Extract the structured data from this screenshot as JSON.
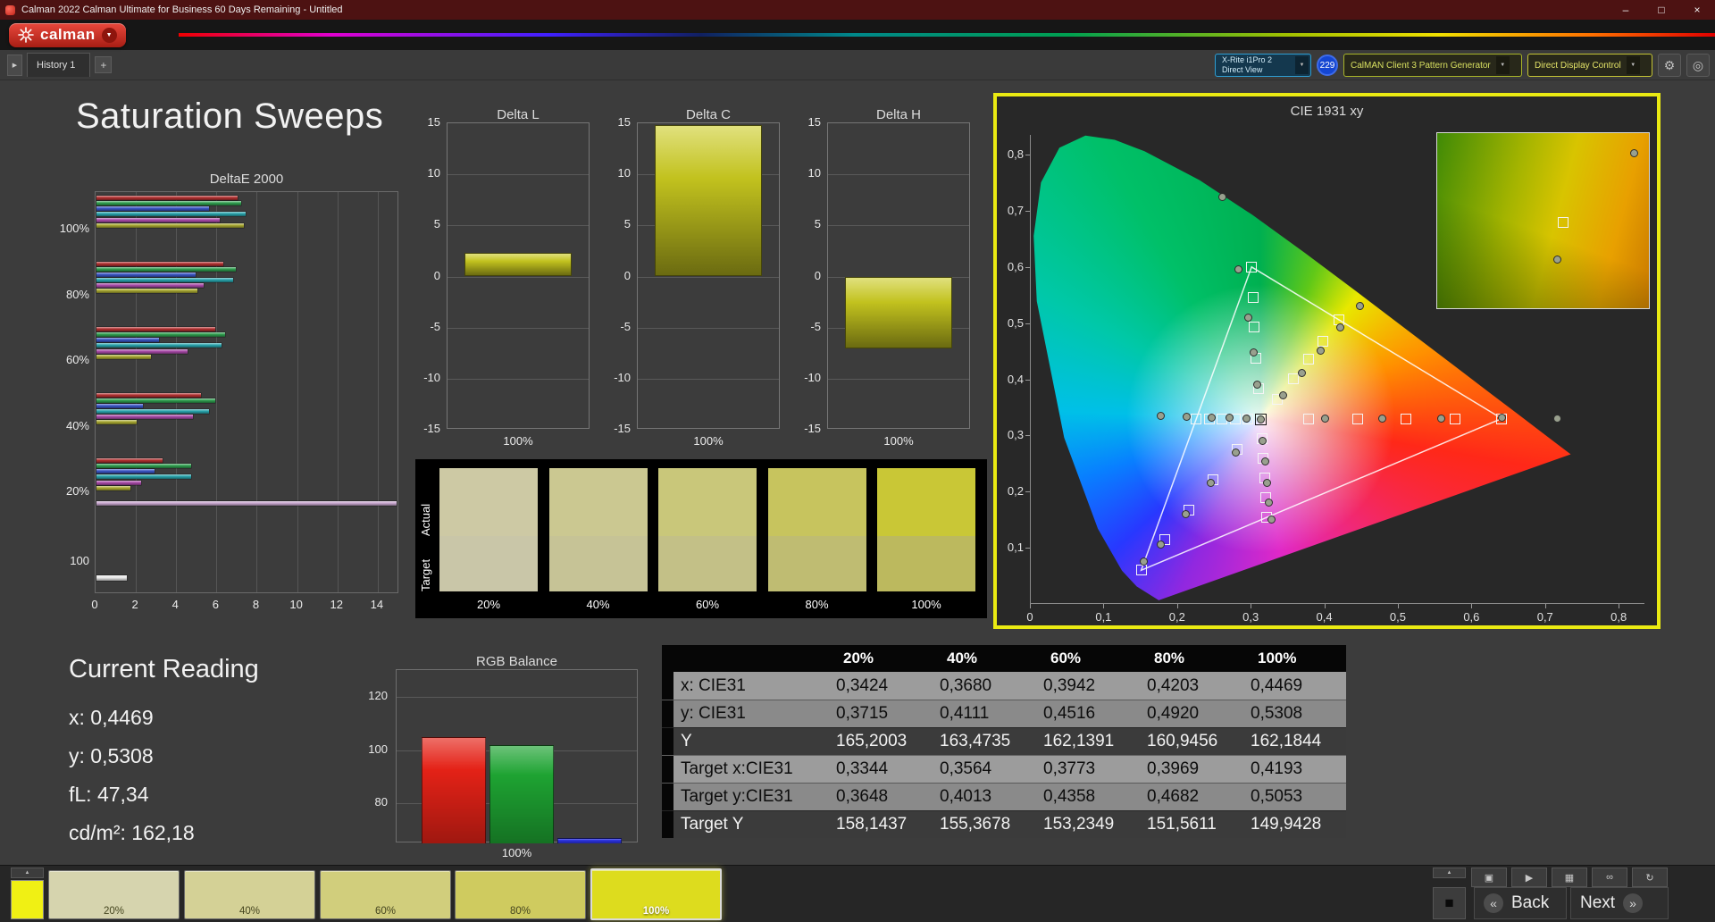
{
  "window": {
    "title": "Calman 2022 Calman Ultimate for Business 60 Days Remaining  - Untitled",
    "minimize": "–",
    "maximize": "□",
    "close": "×"
  },
  "logo": {
    "brand": "calman"
  },
  "tabbar": {
    "scroll_glyph": "▶",
    "history_tab": "History 1",
    "add_tab": "+"
  },
  "devices": {
    "meter_line1": "X-Rite i1Pro 2",
    "meter_line2": "Direct View",
    "badge": "229",
    "source_label": "CalMAN Client 3 Pattern Generator",
    "display_label": "Direct Display Control",
    "caret": "▼",
    "gear": "⚙",
    "target": "◎"
  },
  "page_title": "Saturation Sweeps",
  "deltae": {
    "title": "DeltaE 2000",
    "x_ticks": [
      0,
      2,
      4,
      6,
      8,
      10,
      12,
      14
    ],
    "bar_colors": [
      "#b03030",
      "#2f9e4f",
      "#3a55c4",
      "#2aa4ac",
      "#a84ba8",
      "#a8a832"
    ],
    "groups": [
      {
        "label": "100%",
        "values": [
          7.0,
          7.2,
          5.6,
          7.4,
          6.1,
          7.3
        ]
      },
      {
        "label": "80%",
        "values": [
          6.3,
          6.9,
          4.9,
          6.8,
          5.3,
          5.0
        ]
      },
      {
        "label": "60%",
        "values": [
          5.9,
          6.4,
          3.1,
          6.2,
          4.5,
          2.7
        ]
      },
      {
        "label": "40%",
        "values": [
          5.2,
          5.9,
          2.3,
          5.6,
          4.8,
          2.0
        ]
      },
      {
        "label": "20%",
        "values": [
          3.3,
          4.7,
          2.9,
          4.7,
          2.2,
          1.7
        ]
      }
    ],
    "overflow_bar": {
      "value": 14.9,
      "color": "#c9a8d0"
    },
    "white_bar": {
      "label": "100",
      "value": 1.5,
      "color": "#e8e8e8"
    }
  },
  "delta_axis": {
    "min": -15,
    "max": 15,
    "ticks": [
      15,
      10,
      5,
      0,
      -5,
      -10,
      -15
    ]
  },
  "delta_charts": [
    {
      "title": "Delta L",
      "value": 2.3,
      "x_label": "100%"
    },
    {
      "title": "Delta C",
      "value": 14.8,
      "x_label": "100%"
    },
    {
      "title": "Delta H",
      "value": -7.0,
      "x_label": "100%"
    }
  ],
  "patches": {
    "row_labels": [
      "Actual",
      "Target"
    ],
    "columns": [
      {
        "label": "20%",
        "actual": "#cdc9a4",
        "target": "#c9c6a8"
      },
      {
        "label": "40%",
        "actual": "#cbc891",
        "target": "#c6c396"
      },
      {
        "label": "60%",
        "actual": "#c9c77a",
        "target": "#c3c087"
      },
      {
        "label": "80%",
        "actual": "#c7c45e",
        "target": "#bfbc72"
      },
      {
        "label": "100%",
        "actual": "#c9c736",
        "target": "#bcb95e"
      }
    ]
  },
  "cie": {
    "title": "CIE 1931 xy",
    "axis_max": 0.835,
    "x_tick_values": [
      0,
      0.1,
      0.2,
      0.3,
      0.4,
      0.5,
      0.6,
      0.7,
      0.8
    ],
    "x_tick_labels": [
      "0",
      "0,1",
      "0,2",
      "0,3",
      "0,4",
      "0,5",
      "0,6",
      "0,7",
      "0,8"
    ],
    "y_tick_values": [
      0.1,
      0.2,
      0.3,
      0.4,
      0.5,
      0.6,
      0.7,
      0.8
    ],
    "y_tick_labels": [
      "0,1",
      "0,2",
      "0,3",
      "0,4",
      "0,5",
      "0,6",
      "0,7",
      "0,8"
    ],
    "gamut_triangle": [
      [
        0.64,
        0.33
      ],
      [
        0.3,
        0.6
      ],
      [
        0.15,
        0.06
      ]
    ],
    "white_point": [
      0.3127,
      0.329
    ],
    "targets": [
      [
        0.378,
        0.33
      ],
      [
        0.444,
        0.33
      ],
      [
        0.51,
        0.33
      ],
      [
        0.576,
        0.33
      ],
      [
        0.64,
        0.33
      ],
      [
        0.3344,
        0.3648
      ],
      [
        0.3564,
        0.4013
      ],
      [
        0.3773,
        0.4358
      ],
      [
        0.3969,
        0.4682
      ],
      [
        0.4193,
        0.5053
      ],
      [
        0.3096,
        0.3837
      ],
      [
        0.3064,
        0.4381
      ],
      [
        0.3032,
        0.4925
      ],
      [
        0.3016,
        0.5463
      ],
      [
        0.3,
        0.6
      ],
      [
        0.2951,
        0.329
      ],
      [
        0.2776,
        0.329
      ],
      [
        0.2601,
        0.329
      ],
      [
        0.2426,
        0.329
      ],
      [
        0.225,
        0.329
      ],
      [
        0.2802,
        0.2752
      ],
      [
        0.2476,
        0.2214
      ],
      [
        0.2151,
        0.1676
      ],
      [
        0.1826,
        0.1138
      ],
      [
        0.15,
        0.06
      ],
      [
        0.3143,
        0.294
      ],
      [
        0.316,
        0.2591
      ],
      [
        0.3176,
        0.2241
      ],
      [
        0.3193,
        0.1892
      ],
      [
        0.3209,
        0.1542
      ]
    ],
    "measurements": [
      [
        0.3127,
        0.329
      ],
      [
        0.4,
        0.33
      ],
      [
        0.478,
        0.33
      ],
      [
        0.558,
        0.33
      ],
      [
        0.64,
        0.331
      ],
      [
        0.715,
        0.33
      ],
      [
        0.3424,
        0.3715
      ],
      [
        0.368,
        0.4111
      ],
      [
        0.3942,
        0.4516
      ],
      [
        0.4203,
        0.492
      ],
      [
        0.4469,
        0.5308
      ],
      [
        0.308,
        0.39
      ],
      [
        0.303,
        0.448
      ],
      [
        0.295,
        0.51
      ],
      [
        0.282,
        0.595
      ],
      [
        0.26,
        0.725
      ],
      [
        0.293,
        0.3305
      ],
      [
        0.27,
        0.331
      ],
      [
        0.246,
        0.332
      ],
      [
        0.212,
        0.333
      ],
      [
        0.176,
        0.3345
      ],
      [
        0.279,
        0.27
      ],
      [
        0.245,
        0.215
      ],
      [
        0.21,
        0.16
      ],
      [
        0.176,
        0.105
      ],
      [
        0.153,
        0.075
      ],
      [
        0.315,
        0.29
      ],
      [
        0.318,
        0.253
      ],
      [
        0.321,
        0.215
      ],
      [
        0.324,
        0.18
      ],
      [
        0.327,
        0.15
      ]
    ],
    "inset_markers": [
      {
        "shape": "circle",
        "x": 91,
        "y": 9
      },
      {
        "shape": "square",
        "x": 57,
        "y": 48
      },
      {
        "shape": "circle",
        "x": 55,
        "y": 70
      }
    ]
  },
  "current_reading": {
    "title": "Current Reading",
    "lines": [
      "x: 0,4469",
      "y: 0,5308",
      "fL: 47,34",
      "cd/m²: 162,18"
    ]
  },
  "rgb_balance": {
    "title": "RGB Balance",
    "x_label": "100%",
    "y_min": 65,
    "y_max": 130,
    "y_ticks": [
      120,
      100,
      80
    ],
    "bars": [
      {
        "name": "red",
        "value": 105,
        "color": "#e42217"
      },
      {
        "name": "green",
        "value": 102,
        "color": "#1ea332"
      },
      {
        "name": "blue",
        "value": 67,
        "color": "#2b32e0"
      }
    ]
  },
  "table": {
    "headers": [
      "20%",
      "40%",
      "60%",
      "80%",
      "100%"
    ],
    "rows": [
      {
        "label": "x: CIE31",
        "shade": "light",
        "values": [
          "0,3424",
          "0,3680",
          "0,3942",
          "0,4203",
          "0,4469"
        ]
      },
      {
        "label": "y: CIE31",
        "shade": "medium",
        "values": [
          "0,3715",
          "0,4111",
          "0,4516",
          "0,4920",
          "0,5308"
        ]
      },
      {
        "label": "Y",
        "shade": "dark",
        "values": [
          "165,2003",
          "163,4735",
          "162,1391",
          "160,9456",
          "162,1844"
        ]
      },
      {
        "label": "Target x:CIE31",
        "shade": "light",
        "values": [
          "0,3344",
          "0,3564",
          "0,3773",
          "0,3969",
          "0,4193"
        ]
      },
      {
        "label": "Target y:CIE31",
        "shade": "medium",
        "values": [
          "0,3648",
          "0,4013",
          "0,4358",
          "0,4682",
          "0,5053"
        ]
      },
      {
        "label": "Target Y",
        "shade": "dark",
        "values": [
          "158,1437",
          "155,3678",
          "153,2349",
          "151,5611",
          "149,9428"
        ]
      }
    ]
  },
  "bottom": {
    "up_glyph": "▲",
    "stop_glyph": "■",
    "back_chevron": "«",
    "back_label": "Back",
    "next_label": "Next",
    "next_chevron": "»",
    "swatches": [
      {
        "label": "20%",
        "color": "#d6d4ae",
        "selected": false
      },
      {
        "label": "40%",
        "color": "#d4d196",
        "selected": false
      },
      {
        "label": "60%",
        "color": "#d1ce7c",
        "selected": false
      },
      {
        "label": "80%",
        "color": "#cfcb5f",
        "selected": false
      },
      {
        "label": "100%",
        "color": "#dddc1e",
        "selected": true
      }
    ],
    "transport": [
      {
        "name": "pattern-window-button",
        "glyph": "▣"
      },
      {
        "name": "play-patterns-button",
        "glyph": "▶"
      },
      {
        "name": "grid-pattern-button",
        "glyph": "▦"
      },
      {
        "name": "continuous-mode-button",
        "glyph": "∞"
      },
      {
        "name": "loop-mode-button",
        "glyph": "↻"
      }
    ]
  }
}
